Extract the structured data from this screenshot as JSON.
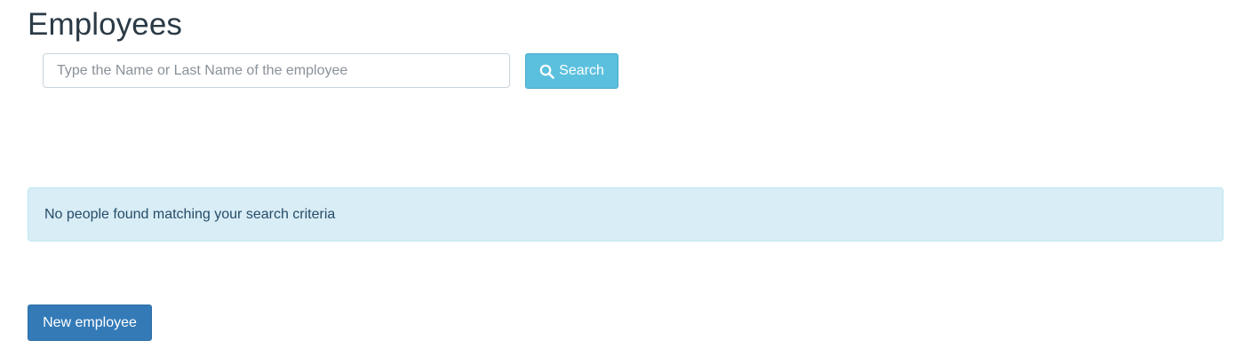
{
  "page": {
    "title": "Employees"
  },
  "search": {
    "placeholder": "Type the Name or Last Name of the employee",
    "value": "",
    "button_label": "Search",
    "button_icon": "search-icon"
  },
  "alert": {
    "message": "No people found matching your search criteria"
  },
  "actions": {
    "new_employee_label": "New employee"
  },
  "colors": {
    "info_button": "#5bc0de",
    "primary_button": "#337ab7",
    "alert_background": "#d9edf7",
    "alert_text": "#254c66",
    "title_text": "#2a3a46"
  }
}
